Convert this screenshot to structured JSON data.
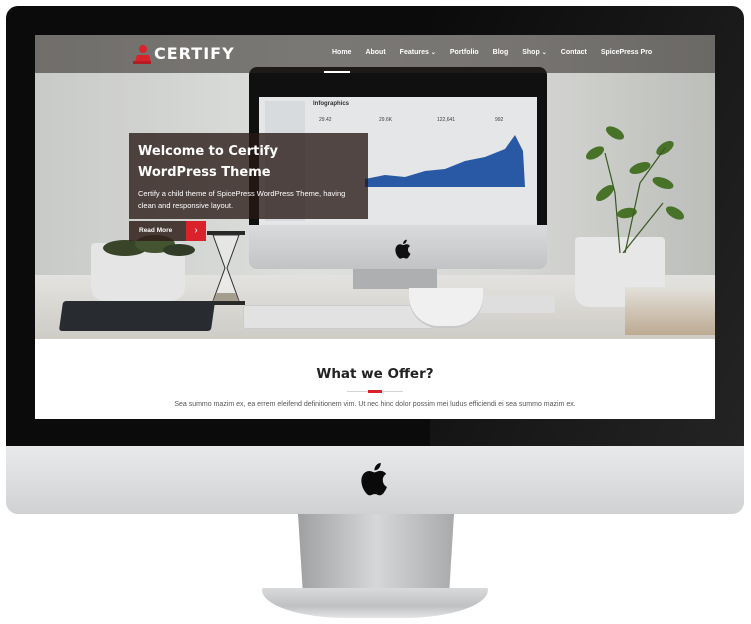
{
  "site": {
    "logo_text": "CERTIFY",
    "accent_color": "#d9222a",
    "nav": [
      {
        "label": "Home",
        "dropdown": false
      },
      {
        "label": "About",
        "dropdown": false
      },
      {
        "label": "Features",
        "dropdown": true
      },
      {
        "label": "Portfolio",
        "dropdown": false
      },
      {
        "label": "Blog",
        "dropdown": false
      },
      {
        "label": "Shop",
        "dropdown": true
      },
      {
        "label": "Contact",
        "dropdown": false
      },
      {
        "label": "SpicePress Pro",
        "dropdown": false
      }
    ],
    "hero": {
      "title": "Welcome to Certify WordPress Theme",
      "description": "Certify a child theme of SpicePress WordPress Theme, having clean and responsive layout.",
      "button_label": "Read More",
      "button_icon": "chevron-right-icon"
    },
    "inner_screen": {
      "heading": "Infographics",
      "stats": [
        "29.42",
        "29.6K",
        "122,641",
        "992"
      ]
    },
    "offer": {
      "title": "What we Offer?",
      "text": "Sea summo mazim ex, ea errem eleifend definitionem vim. Ut nec hinc dolor possim mei ludus efficiendi ei sea summo mazim ex."
    }
  }
}
